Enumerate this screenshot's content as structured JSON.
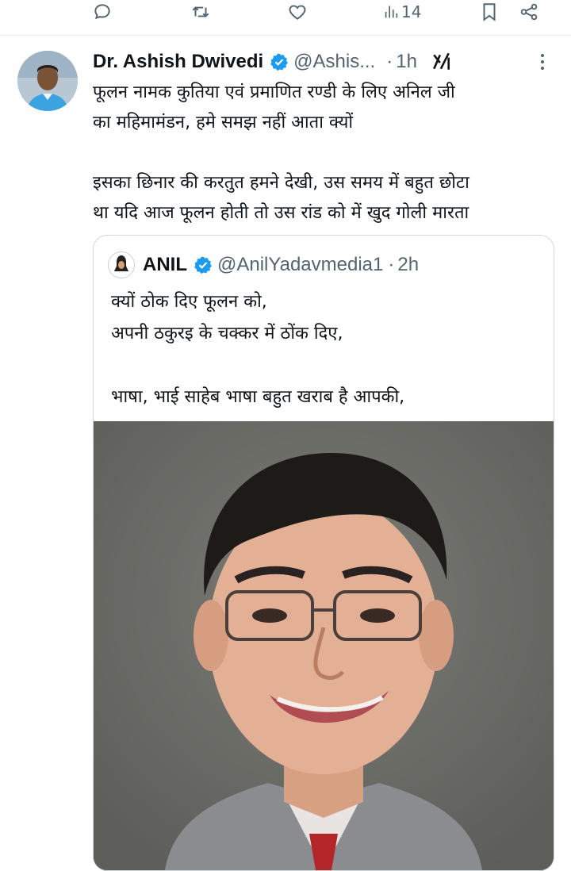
{
  "action_bar": {
    "items": [
      {
        "name": "reply",
        "icon": "reply-icon"
      },
      {
        "name": "repost",
        "icon": "repost-icon"
      },
      {
        "name": "like",
        "icon": "heart-icon"
      },
      {
        "name": "views",
        "icon": "views-icon",
        "count": "14"
      },
      {
        "name": "bookmark",
        "icon": "bookmark-icon"
      },
      {
        "name": "share",
        "icon": "share-icon"
      }
    ]
  },
  "tweet": {
    "author_name": "Dr. Ashish Dwivedi",
    "handle": "@Ashis...",
    "dot": "·",
    "time": "1h",
    "text": [
      "फूलन नामक कुतिया एवं प्रमाणित रण्डी के लिए अनिल जी",
      "का महिमामंडन, हमे समझ नहीं आता क्यों",
      "इसका छिनार की करतुत हमने देखी, उस समय में बहुत छोटा",
      "था यदि आज फूलन होती तो उस रांड को में खुद गोली मारता"
    ]
  },
  "quoted_tweet": {
    "author_name": "ANIL",
    "handle": "@AnilYadavmedia1",
    "dot": "·",
    "time": "2h",
    "text": [
      "क्यों ठोक दिए फूलन को,",
      "अपनी ठकुरइ के चक्कर में ठोंक दिए,",
      "भाषा, भाई साहेब भाषा बहुत खराब है आपकी,"
    ]
  },
  "colors": {
    "verified_blue": "#1d9bf0",
    "secondary_text": "#536471",
    "border": "#cfd9de"
  }
}
